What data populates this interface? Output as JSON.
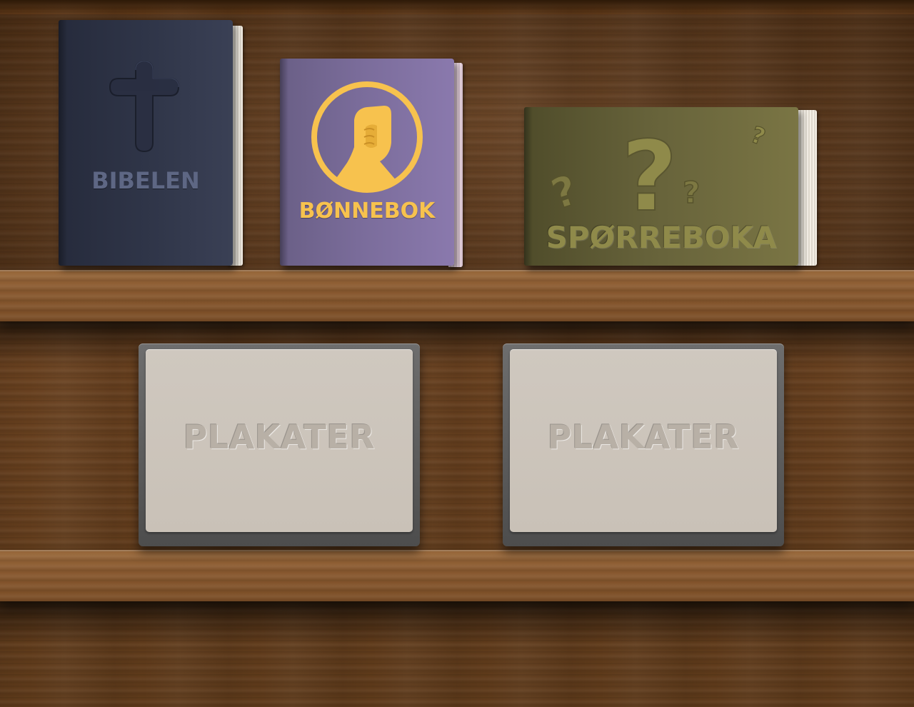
{
  "books": [
    {
      "title": "BIBELEN",
      "icon": "cross-icon",
      "cover_color": "#2b3145",
      "title_color": "#5e6784"
    },
    {
      "title": "BØNNEBOK",
      "icon": "praying-hands-icon",
      "cover_color": "#7a6c9a",
      "title_color": "#f7c24e"
    },
    {
      "title": "SPØRREBOKA",
      "icon": "question-marks-icon",
      "cover_color": "#6e6a3a",
      "title_color": "#8f8a4a"
    }
  ],
  "posters": [
    {
      "label": "PLAKATER"
    },
    {
      "label": "PLAKATER"
    }
  ]
}
